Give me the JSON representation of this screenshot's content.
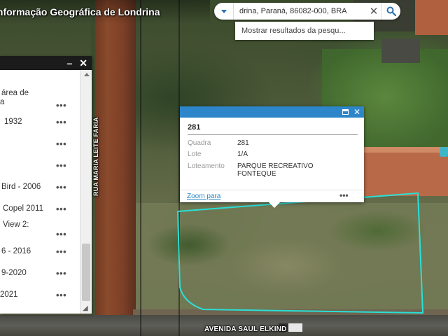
{
  "app": {
    "title": "Informação Geográfica de Londrina"
  },
  "search": {
    "value": "drina, Paraná, 86082-000, BRA",
    "suggestion": "Mostrar resultados da pesqu..."
  },
  "layer_list": {
    "items": [
      {
        "label": "área de",
        "label2": "a"
      },
      {
        "label": "1932"
      },
      {
        "label": ""
      },
      {
        "label": ""
      },
      {
        "label": "Bird - 2006"
      },
      {
        "label": "Copel 2011"
      },
      {
        "label": "View 2:"
      },
      {
        "label": "6 - 2016"
      },
      {
        "label": "9-2020"
      },
      {
        "label": "2021"
      }
    ],
    "more_glyph": "•••"
  },
  "popup": {
    "title": "281",
    "attributes": [
      {
        "key": "Quadra",
        "value": "281"
      },
      {
        "key": "Lote",
        "value": "1/A"
      },
      {
        "key": "Loteamento",
        "value": "PARQUE RECREATIVO",
        "value2": "FONTEQUE"
      }
    ],
    "zoom_label": "Zoom para",
    "more_glyph": "•••"
  },
  "map": {
    "street_vertical": "RUA MARIA LEITE FARIA",
    "street_horizontal": "AVENIDA SAUL ELKIND",
    "parcel_color": "#29e0d8"
  },
  "icons": {
    "search": "search-icon",
    "clear": "close-icon",
    "dropdown": "chevron-down-icon",
    "minimize": "minimize-icon",
    "close": "close-icon",
    "maximize": "maximize-icon"
  },
  "colors": {
    "accent": "#2d86c9",
    "panel_header": "#1b1b1b"
  }
}
